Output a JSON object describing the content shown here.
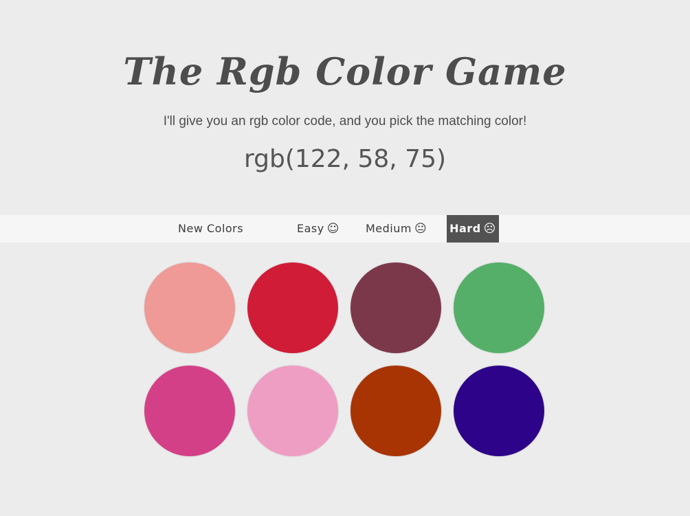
{
  "header": {
    "title": "The Rgb Color Game",
    "subtitle": "I'll give you an rgb color code, and you pick the matching color!",
    "target_rgb": "rgb(122, 58, 75)"
  },
  "navbar": {
    "new_colors": "New Colors",
    "easy": "Easy",
    "easy_face": "☺",
    "medium": "Medium",
    "medium_face": "😐",
    "hard": "Hard",
    "hard_face": "☹",
    "selected": "Hard"
  },
  "board": {
    "colors": [
      "#ef9a96",
      "#d01c37",
      "#7b384b",
      "#55af69",
      "#d44087",
      "#ef9ec3",
      "#a93403",
      "#2d0389"
    ]
  },
  "theme": {
    "background": "#ececec",
    "navbar_background": "#f6f6f6",
    "selected_button": "#525252",
    "text": "#4d4d4d"
  }
}
